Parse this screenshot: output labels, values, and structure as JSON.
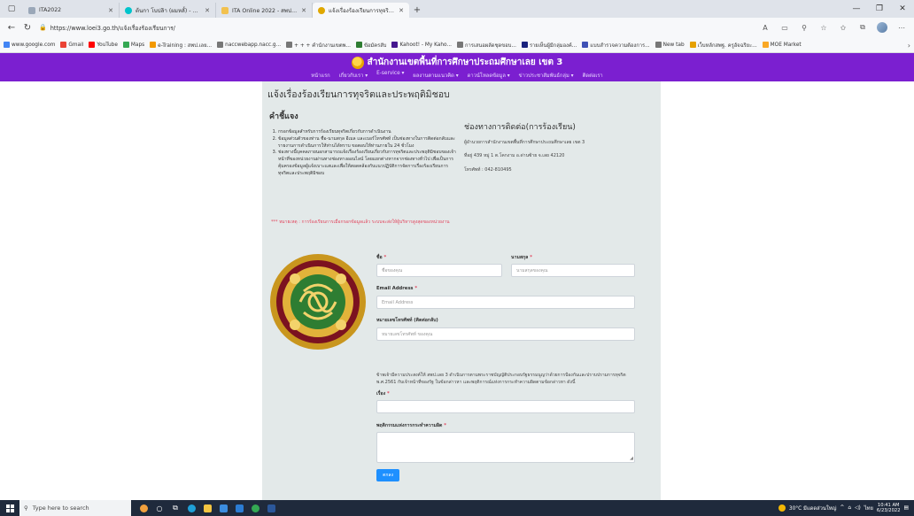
{
  "browser": {
    "tabs": [
      {
        "label": "ITA2022",
        "icon": "document-icon",
        "color": "#9aa7b8",
        "active": false
      },
      {
        "label": "ต้นกา โบปลิา (ผมหลั้) - Canva",
        "icon": "canva-icon",
        "color": "#00c4cc",
        "active": false
      },
      {
        "label": "ITA Online 2022 - สพป.เลย เขต 3",
        "icon": "ita-icon",
        "color": "#f2c14e",
        "active": false
      },
      {
        "label": "แจ้งเรื่องร้องเรียนการทุจริตและประพฤติ",
        "icon": "school-icon",
        "color": "#e0a800",
        "active": true
      }
    ],
    "new_tab_label": "+",
    "url": "https://www.loei3.go.th/แจ้งเรื่องร้องเรียนการ/",
    "favorites": [
      {
        "label": "www.google.com",
        "color": "#4285f4"
      },
      {
        "label": "Gmail",
        "color": "#ea4335"
      },
      {
        "label": "YouTube",
        "color": "#ff0000"
      },
      {
        "label": "Maps",
        "color": "#34a853"
      },
      {
        "label": "e-Training : สพป.เลย...",
        "color": "#f29900"
      },
      {
        "label": "naccwebapp.nacc.g...",
        "color": "#777777"
      },
      {
        "label": "+ + + คำนักงานเขตพ...",
        "color": "#777777"
      },
      {
        "label": "ข้อมัครสับ",
        "color": "#2e7d32"
      },
      {
        "label": "Kahoot! - My Kaho...",
        "color": "#46178f"
      },
      {
        "label": "การเสนอผลัดชุดขอบ...",
        "color": "#777777"
      },
      {
        "label": "รายเห็นผู้มีกลุ่มองค์...",
        "color": "#1a237e"
      },
      {
        "label": "แบบสำรวจความต้องการ...",
        "color": "#3f51b5"
      },
      {
        "label": "New tab",
        "color": "#777777"
      },
      {
        "label": "เว็บหลักสพฐ. ครูอัจฉริยะ...",
        "color": "#e6a100"
      },
      {
        "label": "MOE Market",
        "color": "#f9a825"
      }
    ]
  },
  "site": {
    "name": "สำนักงานเขตพื้นที่การศึกษาประถมศึกษาเลย เขต 3",
    "nav": [
      "หน้าแรก",
      "เกี่ยวกับเรา ▾",
      "E-service ▾",
      "ผลงานตามแนวคิด ▾",
      "ดาวน์โหลดข้อมูล ▾",
      "ข่าวประชาสัมพันธ์กลุ่ม ▾",
      "ติดต่อเรา"
    ]
  },
  "page": {
    "title": "แจ้งเรื่องร้องเรียนการทุจริตและประพฤติมิชอบ",
    "intro_heading": "คำชี้แจง",
    "intro_items": [
      "กรอกข้อมูลสำหรับการร้องเรียนทุจริตเกี่ยวกับการดำเนินงาน",
      "ข้อมูลส่วนตัวของท่าน ชื่อ-นามสกุล อีเมล และเบอร์โทรศัพท์ เป็นช่องทางในการติดต่อกลับและรายงานการดำเนินการให้ท่านได้ทราบ ขอตอบให้ท่านภายใน 24 ชั่วโมง",
      "ช่องทางนี้บุคคลภายนอกสามารถแจ้งเรื่องร้องเรียนเกี่ยวกับการทุจริตและประพฤติมิชอบของเจ้าหน้าที่ของหน่วยงานผ่านทางช่องทางออนไลน์ โดยแยกต่างหากจากช่องทางทั่วไป เพื่อเป็นการคุ้มครองข้อมูลผู้แจ้งเบาะแสและเพื่อให้สอดคล้องกับแนวปฏิบัติการจัดการเรื่องร้องเรียนการทุจริตและประพฤติมิชอบ"
    ],
    "warning": "*** หมายเหตุ : การร้องเรียนการเมื่อกรอกข้อมูลแล้ว ระบบจะส่งให้ผู้บริหารสูงสุดของหน่วยงาน",
    "contact_heading": "ช่องทางการติดต่อ(การร้องเรียน)",
    "contact_lines": [
      "ผู้อำนวยการสำนักงานเขตพื้นที่การศึกษาประถมศึกษาเลย เขต 3",
      "ที่อยู่ 439 หมู่ 1 ต.โคกงาม อ.ด่านซ้าย จ.เลย 42120",
      "โทรศัพท์ : 042-810495"
    ]
  },
  "form": {
    "first_name_label": "ชื่อ",
    "first_name_placeholder": "ชื่อของคุณ",
    "last_name_label": "นามสกุล",
    "last_name_placeholder": "นามสกุลของคุณ",
    "email_label": "Email Address",
    "email_placeholder": "Email Address",
    "phone_label": "หมายเลขโทรศัพท์ (ติดต่อกลับ)",
    "phone_placeholder": "หมายเลขโทรศัพท์ ของคุณ",
    "consent": "ข้าพเจ้ามีความประสงค์ให้ สพป.เลย 3 ดำเนินการตามพระราชบัญญัติประกอบรัฐธรรมนูญว่าด้วยการป้องกันและปราบปรามการทุจริต พ.ศ.2561 กับเจ้าหน้าที่ของรัฐ ในข้อกล่าวหา และพฤติการณ์แห่งการกระทำความผิดตามข้อกล่าวหา ดังนี้",
    "subject_label": "เรื่อง",
    "subject_value": "",
    "detail_label": "พฤติกรรมแห่งการกระทำความผิด",
    "submit_label": "ตกลง",
    "required_mark": "*"
  },
  "taskbar": {
    "search_placeholder": "Type here to search",
    "weather": "30°C มีแดดส่วนใหญ่",
    "lang": "ไทย",
    "time": "10:41 AM",
    "date": "6/23/2022"
  }
}
